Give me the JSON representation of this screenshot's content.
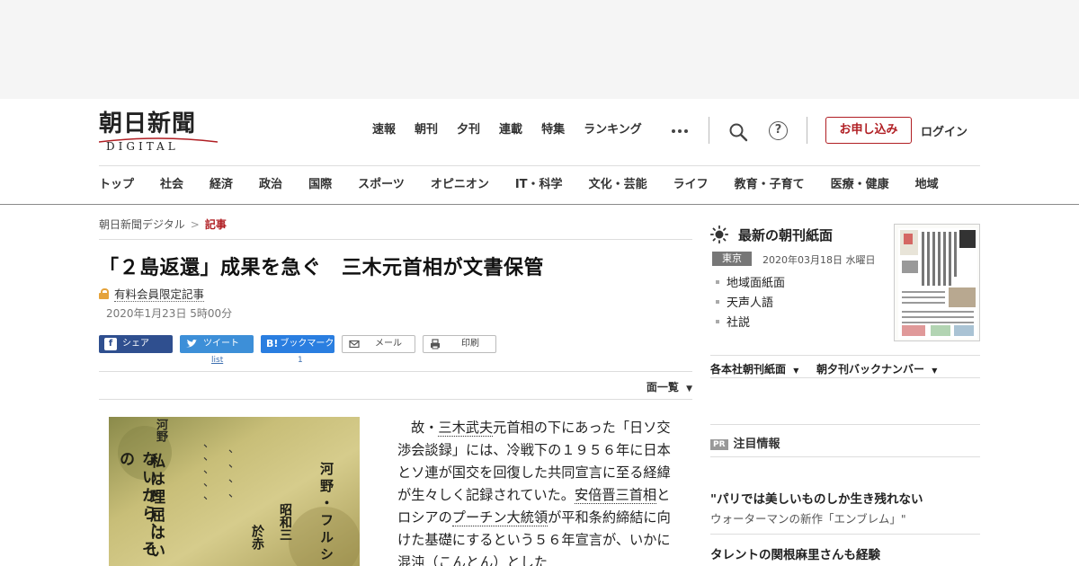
{
  "logo": {
    "main": "朝日新聞",
    "sub": "DIGITAL"
  },
  "topnav": [
    "速報",
    "朝刊",
    "夕刊",
    "連載",
    "特集",
    "ランキング"
  ],
  "header": {
    "apply_label": "お申し込み",
    "login_label": "ログイン",
    "help_glyph": "?"
  },
  "catnav": [
    "トップ",
    "社会",
    "経済",
    "政治",
    "国際",
    "スポーツ",
    "オピニオン",
    "IT・科学",
    "文化・芸能",
    "ライフ",
    "教育・子育て",
    "医療・健康",
    "地域"
  ],
  "breadcrumb": {
    "home": "朝日新聞デジタル",
    "sep": ">",
    "current": "記事"
  },
  "article": {
    "title": "「２島返還」成果を急ぐ　三木元首相が文書保管",
    "members_only": "有料会員限定記事",
    "date": "2020年1月23日 5時00分",
    "page_list": "面一覧",
    "photo_lines": [
      "河野",
      "私は理屈はい",
      "ないから、その",
      "河野・フルシ",
      "昭和三",
      "於赤"
    ],
    "body": {
      "p1": "故・",
      "link1": "三木武夫",
      "p2": "元首相の下にあった「日ソ交渉会談録」には、冷戦下の１９５６年に日本とソ連が国交を回復した共同宣言に至る経緯が生々しく記録されていた。",
      "link2": "安倍晋三首相",
      "p3": "とロシアの",
      "link3": "プーチン大統領",
      "p4": "が平和条約締結に向けた基礎にするという５６年宣言が、いかに混沌（こんとん）とした"
    }
  },
  "share": {
    "facebook": "シェア",
    "facebook_icon": "f",
    "twitter": "ツイート",
    "twitter_count": "list",
    "hatena": "ブックマーク",
    "hatena_icon": "B!",
    "hatena_count": "1",
    "mail": "メール",
    "print": "印刷"
  },
  "sidebar": {
    "title": "最新の朝刊紙面",
    "edition": "東京",
    "date": "2020年03月18日 水曜日",
    "items": [
      "地域面紙面",
      "天声人語",
      "社説"
    ],
    "dropdown1": "各本社朝刊紙面",
    "dropdown2": "朝夕刊バックナンバー",
    "pr_badge": "PR",
    "pr_title": "注目情報",
    "news1_title": "\"パリでは美しいものしか生き残れない",
    "news1_sub": "ウォーターマンの新作「エンブレム」\"",
    "news2_title": "タレントの関根麻里さんも経験"
  },
  "colors": {
    "accent": "#b01e23",
    "facebook": "#2f4f8f",
    "twitter": "#3d8fd8",
    "hatena": "#2a7ee0",
    "lock": "#e5a33b"
  }
}
